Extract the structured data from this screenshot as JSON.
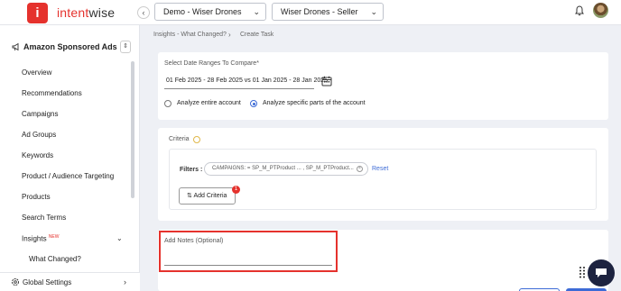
{
  "brand": {
    "logo_letter": "i",
    "name_part1": "intent",
    "name_part2": "wise",
    "accent": "#e5322d"
  },
  "header": {
    "collapse_icon": "chevron-left-icon",
    "account_dropdown": "Demo - Wiser Drones",
    "profile_dropdown": "Wiser Drones - Seller",
    "notification_icon": "bell-icon",
    "avatar_icon": "user-avatar"
  },
  "sidebar": {
    "section_label": "Amazon Sponsored Ads",
    "items": [
      {
        "label": "Overview"
      },
      {
        "label": "Recommendations"
      },
      {
        "label": "Campaigns"
      },
      {
        "label": "Ad Groups"
      },
      {
        "label": "Keywords"
      },
      {
        "label": "Product / Audience Targeting"
      },
      {
        "label": "Products"
      },
      {
        "label": "Search Terms"
      }
    ],
    "insights": {
      "label": "Insights",
      "badge": "NEW",
      "sub_item": "What Changed?"
    },
    "footer_label": "Global Settings"
  },
  "breadcrumb": {
    "parent": "Insights - What Changed?",
    "current": "Create Task"
  },
  "date_section": {
    "label": "Select Date Ranges To Compare*",
    "value": "01 Feb 2025 - 28 Feb 2025 vs 01 Jan 2025 - 28 Jan 2025",
    "options": [
      {
        "label": "Analyze entire account",
        "selected": false
      },
      {
        "label": "Analyze specific parts of the account",
        "selected": true
      }
    ]
  },
  "criteria": {
    "title": "Criteria",
    "filters_label": "Filters :",
    "filter_chip": "CAMPAIGNS: = SP_M_PTProduct ... , SP_M_PTProduct...",
    "reset_label": "Reset",
    "add_button_label": "Add Criteria",
    "add_badge": "1"
  },
  "notes": {
    "label": "Add Notes (Optional)"
  },
  "colors": {
    "primary": "#3d6bd6",
    "highlight_border": "#e5322d"
  }
}
